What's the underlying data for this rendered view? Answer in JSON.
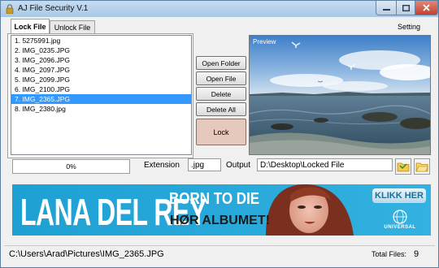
{
  "window": {
    "title": "AJ File Security V.1"
  },
  "tabs": [
    {
      "label": "Lock File",
      "active": true
    },
    {
      "label": "Unlock File",
      "active": false
    }
  ],
  "setting_label": "Setting",
  "files": [
    {
      "label": "1.  5275991.jpg",
      "selected": false
    },
    {
      "label": "2.  IMG_0235.JPG",
      "selected": false
    },
    {
      "label": "3.  IMG_2096.JPG",
      "selected": false
    },
    {
      "label": "4.  IMG_2097.JPG",
      "selected": false
    },
    {
      "label": "5.  IMG_2099.JPG",
      "selected": false
    },
    {
      "label": "6.  IMG_2100.JPG",
      "selected": false
    },
    {
      "label": "7.  IMG_2365.JPG",
      "selected": true
    },
    {
      "label": "8.  IMG_2380.jpg",
      "selected": false
    }
  ],
  "buttons": {
    "open_folder": "Open Folder",
    "open_file": "Open File",
    "delete": "Delete",
    "delete_all": "Delete All",
    "lock": "Lock"
  },
  "preview": {
    "label": "Preview"
  },
  "progress": {
    "text": "0%",
    "value": 0
  },
  "extension": {
    "label": "Extension",
    "value": ".jpg"
  },
  "output": {
    "label": "Output",
    "value": "D:\\Desktop\\Locked File"
  },
  "banner": {
    "artist": "LANA DEL REY",
    "album": "BORN TO DIE",
    "tagline": "HØR ALBUMET!",
    "cta": "KLIKK HER",
    "label": "UNIVERSAL"
  },
  "status": {
    "path": "C:\\Users\\Arad\\Pictures\\IMG_2365.JPG",
    "total_label": "Total Files:",
    "total_count": "9"
  },
  "colors": {
    "selection": "#3399ff",
    "lock_button": "#e6c9bd",
    "banner_bg": "#2aa7d6",
    "titlebar": "#b6cfe9",
    "close_button": "#c94a38"
  }
}
